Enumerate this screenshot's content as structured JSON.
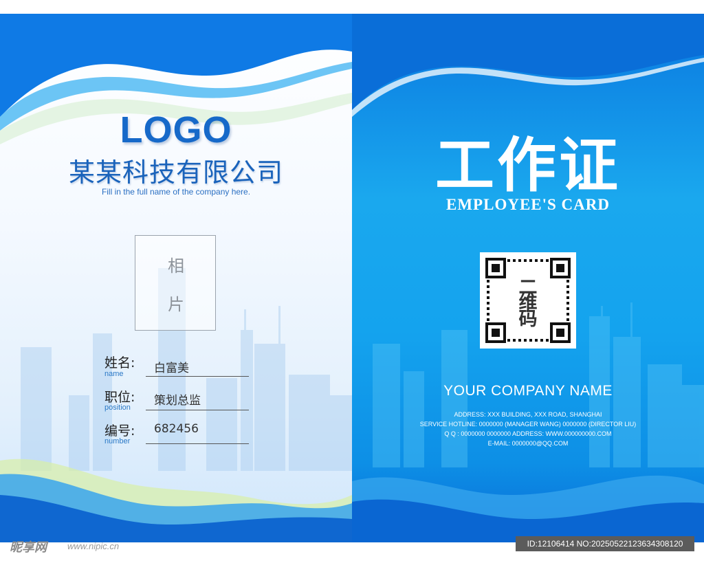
{
  "left_card": {
    "logo": "LOGO",
    "company_name_cn": "某某科技有限公司",
    "company_name_hint": "Fill in the full name of the company here.",
    "photo_placeholder": [
      "相",
      "片"
    ],
    "fields": [
      {
        "label": "姓名:",
        "sub": "name",
        "value": "白富美"
      },
      {
        "label": "职位:",
        "sub": "position",
        "value": "策划总监"
      },
      {
        "label": "编号:",
        "sub": "number",
        "value": "682456"
      }
    ]
  },
  "right_card": {
    "title_cn": "工作证",
    "title_en": "EMPLOYEE'S CARD",
    "qr_label": [
      "二",
      "维",
      "码"
    ],
    "company_name_en": "YOUR COMPANY NAME",
    "info_lines": [
      "ADDRESS: XXX BUILDING, XXX ROAD, SHANGHAI",
      "SERVICE HOTLINE: 0000000 (MANAGER WANG) 0000000 (DIRECTOR LIU)",
      "Q Q :  0000000 0000000  ADDRESS: WWW.000000000.COM",
      "E-MAIL:   0000000@QQ.COM"
    ]
  },
  "watermark": {
    "site_name": "昵享网",
    "url": "www.nipic.cn",
    "id_text": "ID:12106414 NO:20250522123634308120"
  },
  "colors": {
    "brand_blue": "#1669c9",
    "right_bg": "#14a3ee",
    "text_white": "#ffffff"
  }
}
